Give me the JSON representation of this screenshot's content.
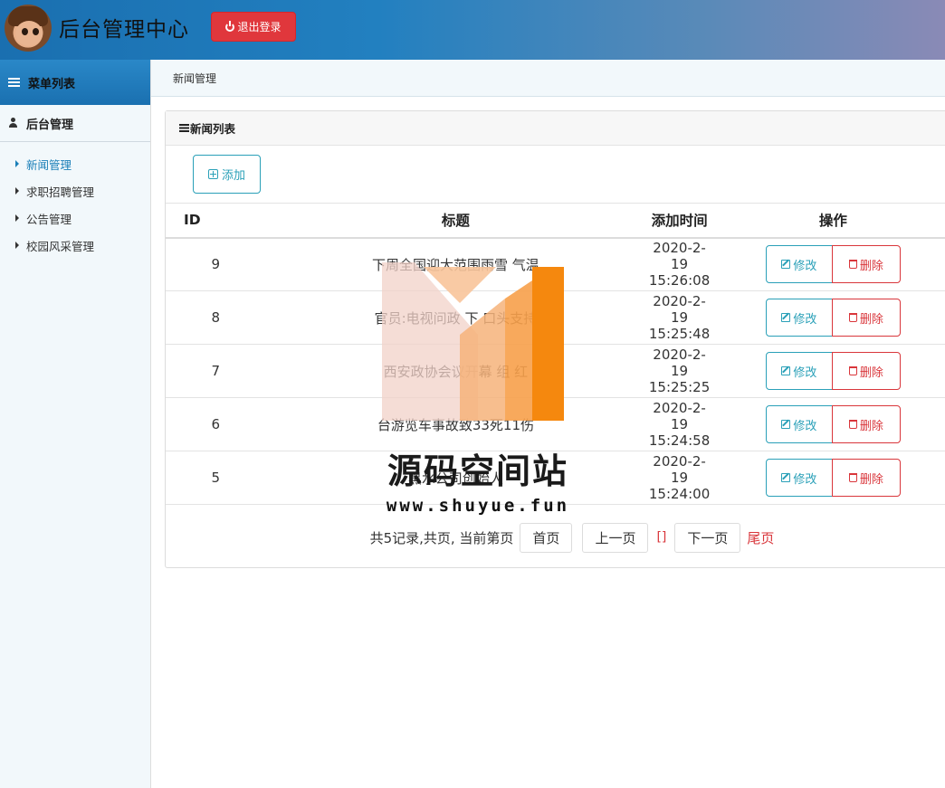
{
  "header": {
    "app_title": "后台管理中心",
    "logout_label": "退出登录",
    "accent_color": "#e0373c"
  },
  "sidebar": {
    "menu_title": "菜单列表",
    "group_title": "后台管理",
    "items": [
      {
        "label": "新闻管理",
        "active": true
      },
      {
        "label": "求职招聘管理",
        "active": false
      },
      {
        "label": "公告管理",
        "active": false
      },
      {
        "label": "校园风采管理",
        "active": false
      }
    ]
  },
  "breadcrumb": "新闻管理",
  "panel": {
    "title": "新闻列表",
    "add_label": "添加",
    "columns": [
      "ID",
      "标题",
      "添加时间",
      "操作"
    ],
    "edit_label": "修改",
    "delete_label": "删除",
    "rows": [
      {
        "id": "9",
        "title": "下周全国迎大范围雨雪 气温",
        "time": "2020-2-19 15:26:08"
      },
      {
        "id": "8",
        "title": "官员:电视问政 下 口头支持",
        "time": "2020-2-19 15:25:48"
      },
      {
        "id": "7",
        "title": "西安政协会议开幕 组 红",
        "time": "2020-2-19 15:25:25"
      },
      {
        "id": "6",
        "title": "台游览车事故致33死11伤",
        "time": "2020-2-19 15:24:58"
      },
      {
        "id": "5",
        "title": "黑水公司创始人",
        "time": "2020-2-19 15:24:00"
      }
    ]
  },
  "pager": {
    "info": "共5记录,共页, 当前第页",
    "first": "首页",
    "prev": "上一页",
    "current": "[]",
    "next": "下一页",
    "last": "尾页"
  },
  "watermark": {
    "name": "源码空间站",
    "url": "www.shuyue.fun"
  }
}
